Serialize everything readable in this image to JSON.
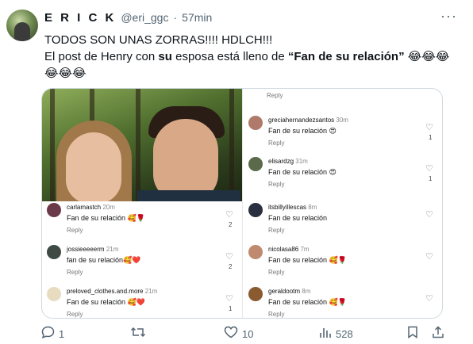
{
  "tweet": {
    "name": "E R I C K",
    "handle": "@eri_ggc",
    "separator": "·",
    "time": "57min",
    "more": "···",
    "line1": "TODOS SON UNAS ZORRAS!!!! HDLCH!!!",
    "line2_a": "El post de Henry con ",
    "line2_bold1": "su",
    "line2_b": " esposa está lleno de ",
    "line2_bold2": "“Fan de su relación”",
    "line2_emoji": " 😂😂😂",
    "line3_emoji": "😂😂😂"
  },
  "comments_left": [
    {
      "user": "carlamastch",
      "ago": "20m",
      "text": "Fan de su relación 🥰🌹",
      "reply": "Reply",
      "likes": "2",
      "avatar_color": "#6a3a4a"
    },
    {
      "user": "jossieeeeerm",
      "ago": "21m",
      "text": "fan de su relación🥰❤️",
      "reply": "Reply",
      "likes": "2",
      "avatar_color": "#3f4a44"
    },
    {
      "user": "preloved_clothes.and.more",
      "ago": "21m",
      "text": "Fan de su relación 🥰❤️",
      "reply": "Reply",
      "likes": "1",
      "avatar_color": "#e8dcc0"
    }
  ],
  "comments_right": [
    {
      "user": "",
      "ago": "",
      "text": "",
      "reply": "Reply",
      "likes": "",
      "avatar_color": ""
    },
    {
      "user": "greciahernandezsantos",
      "ago": "30m",
      "text": "Fan de su relación 😍",
      "reply": "Reply",
      "likes": "1",
      "avatar_color": "#b07a6a"
    },
    {
      "user": "elisardzg",
      "ago": "31m",
      "text": "Fan de su relación 😍",
      "reply": "Reply",
      "likes": "1",
      "avatar_color": "#5a6a4a"
    },
    {
      "user": "itsbillyillescas",
      "ago": "8m",
      "text": "Fan de su relación",
      "reply": "Reply",
      "likes": "",
      "avatar_color": "#2a3040"
    },
    {
      "user": "nicolasa86",
      "ago": "7m",
      "text": "Fan de su relación 🥰🌹",
      "reply": "Reply",
      "likes": "",
      "avatar_color": "#c08a70"
    },
    {
      "user": "geraldootm",
      "ago": "8m",
      "text": "Fan de su relación 🥰🌹",
      "reply": "Reply",
      "likes": "",
      "avatar_color": "#8a5a30"
    }
  ],
  "actions": {
    "replies": "1",
    "retweets": "",
    "likes": "10",
    "views": "528"
  }
}
